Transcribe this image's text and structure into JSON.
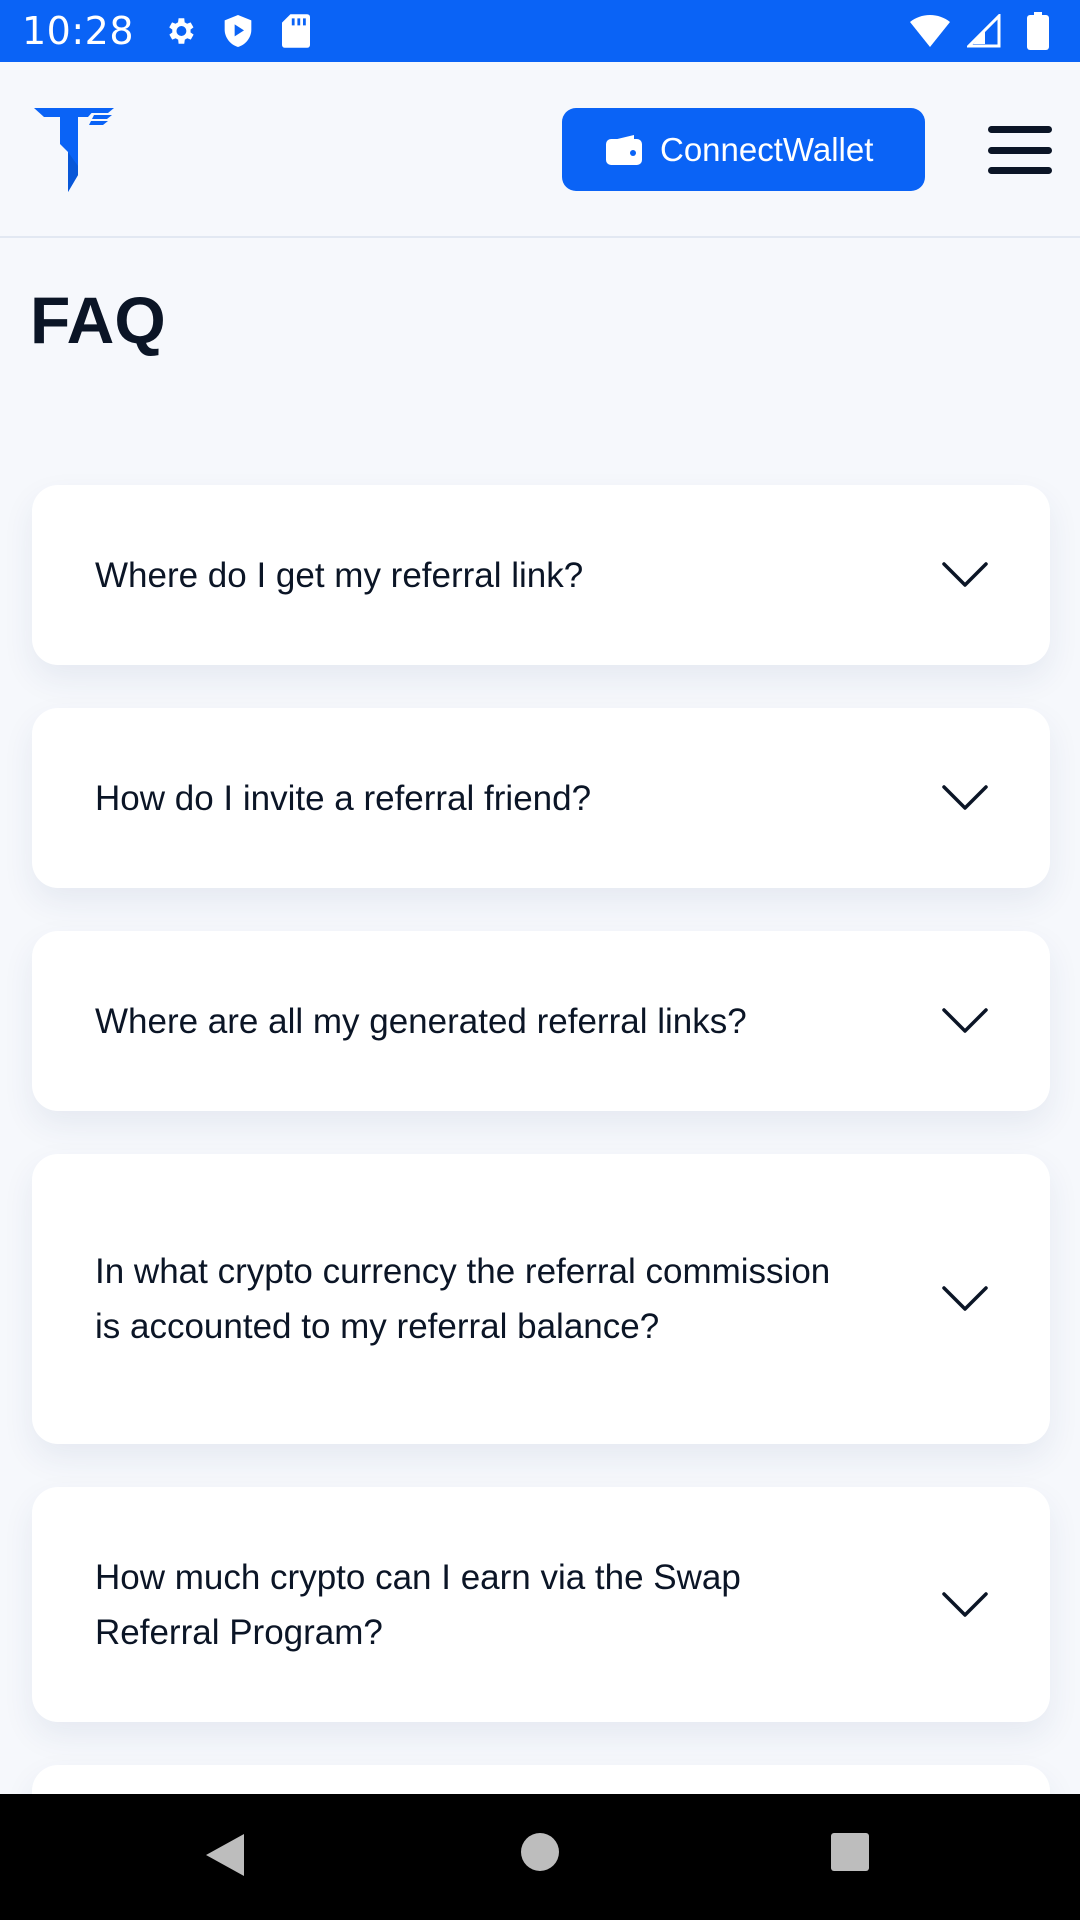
{
  "status_bar": {
    "time": "10:28",
    "icons": [
      "gear-icon",
      "shield-icon",
      "sd-card-icon",
      "wifi-icon",
      "cell-signal-icon",
      "battery-icon"
    ]
  },
  "header": {
    "logo": "t-logo",
    "connect_button_label": "ConnectWallet",
    "connect_icon": "wallet-icon",
    "menu_icon": "hamburger-menu-icon"
  },
  "page": {
    "title": "FAQ"
  },
  "faq": [
    {
      "question": "Where do I get my referral link?"
    },
    {
      "question": "How do I invite a referral friend?"
    },
    {
      "question": "Where are all my generated referral links?"
    },
    {
      "question": "In what crypto currency the referral commission is accounted to my referral balance?"
    },
    {
      "question": "How much crypto can I earn via the Swap Referral Program?"
    }
  ],
  "nav_bar": {
    "icons": [
      "back-triangle-icon",
      "home-circle-icon",
      "recents-square-icon"
    ]
  },
  "colors": {
    "accent": "#0a63f6",
    "background": "#f6f8fc",
    "text": "#0b1526",
    "card": "#ffffff"
  }
}
